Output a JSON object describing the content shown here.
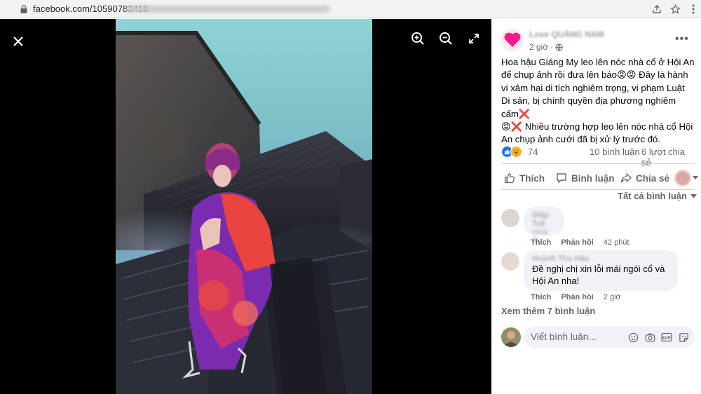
{
  "browser": {
    "url": "facebook.com/10590783418"
  },
  "viewer": {
    "close_icon": "close-icon",
    "zoom_in_icon": "zoom-in-icon",
    "zoom_out_icon": "zoom-out-icon",
    "fullscreen_icon": "fullscreen-icon"
  },
  "post": {
    "page_name": "Love QUẢNG NAM",
    "time": "2 giờ",
    "caption_parts": {
      "p1": "Hoa hậu Giáng My leo lên nóc nhà cổ ở Hội An để chụp ảnh rồi đưa lên báo",
      "e1": "😡😡",
      "p2": " Đây là hành vi xâm hại di tích nghiêm trọng, vi phạm Luật Di sản, bị chính quyền địa phương nghiêm cấm",
      "x1": "❌",
      "e2": "😡",
      "x2": "❌",
      "p3": " Nhiều trường hợp leo lên nóc nhà cổ Hội An chụp ảnh cưới đã bị xử lý trước đó."
    },
    "reaction_count": "74",
    "comment_count": "10 bình luận",
    "share_count": "6 lượt chia sẻ",
    "actions": {
      "like": "Thích",
      "comment": "Bình luận",
      "share": "Chia sẻ"
    },
    "sort_label": "Tất cả bình luận",
    "colors": {
      "like_blue": "#1877f2",
      "haha_yellow": "#f7b125",
      "text_gray": "#65676b"
    }
  },
  "comments": [
    {
      "name": "Diệp Tuệ",
      "text": "Hoài Ốc",
      "like": "Thích",
      "reply": "Phản hồi",
      "time": "42 phút"
    },
    {
      "name": "Huỳnh Thu Hậu",
      "text": "Đề nghị chị xin lỗi mái ngói cổ và Hội An nha!",
      "like": "Thích",
      "reply": "Phản hồi",
      "time": "2 giờ"
    }
  ],
  "see_more": "Xem thêm 7 bình luận",
  "composer": {
    "placeholder": "Viết bình luận...",
    "icons": [
      "emoji-icon",
      "camera-icon",
      "gif-icon",
      "sticker-icon"
    ]
  }
}
